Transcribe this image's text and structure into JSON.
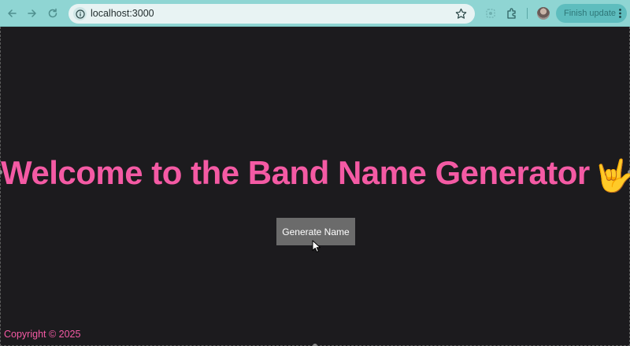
{
  "browser": {
    "url": "localhost:3000",
    "update_button_label": "Finish update",
    "icons": {
      "back": "back-arrow-icon",
      "forward": "forward-arrow-icon",
      "reload": "reload-icon",
      "site_info": "info-icon",
      "bookmark": "star-icon",
      "extension_1": "extension-icon",
      "extension_2": "puzzle-icon",
      "menu": "kebab-menu-icon"
    }
  },
  "page": {
    "title": "Welcome to the Band Name Generator",
    "title_emoji": "🤟",
    "button_label": "Generate Name",
    "footer": "Copyright © 2025"
  },
  "colors": {
    "toolbar": "#8fd5d3",
    "page_background": "#1c1b1e",
    "accent_pink": "#f45aa4",
    "button_background": "#6b6b6b",
    "update_button": "#5ebdbe"
  }
}
